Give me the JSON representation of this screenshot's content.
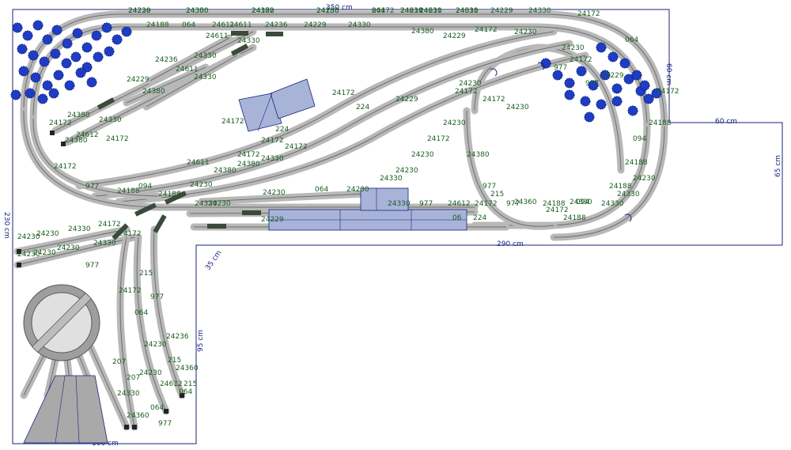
{
  "colors": {
    "board_outline": "#1a237e",
    "track_bed": "#b8b8b8",
    "track_rail": "#6e6e6e",
    "building_fill": "#a8b3d8",
    "building_stroke": "#1a237e",
    "tree": "#1f3cc4",
    "part_label": "#1b5e20",
    "loco": "#3b4a3b"
  },
  "dimensions": {
    "top_length": "350 cm",
    "right_upper_depth": "60 cm",
    "step_width": "60 cm",
    "right_lower_depth": "65 cm",
    "left_height": "230 cm",
    "bottom_width": "290 cm",
    "inner_depth": "35 cm",
    "branch_height": "95 cm",
    "branch_width": "100 cm"
  },
  "track_labels": [
    "24229",
    "24360",
    "24380",
    "24188",
    "064",
    "24611",
    "24611",
    "24611",
    "24229",
    "24330",
    "24172",
    "24188",
    "064",
    "24611",
    "24611",
    "24236",
    "24229",
    "24330",
    "24380",
    "24229",
    "24172",
    "24236",
    "24611",
    "24229",
    "24611",
    "24330",
    "24330",
    "24380",
    "24330",
    "24230",
    "24230",
    "24229",
    "24172",
    "224",
    "24611",
    "24172",
    "24172",
    "24172",
    "224",
    "24229",
    "24380",
    "24380",
    "24330",
    "24172",
    "24172",
    "24380",
    "24330",
    "24380",
    "24612",
    "24172",
    "24172",
    "24380",
    "977",
    "24172",
    "24188",
    "977",
    "094",
    "24188",
    "24230",
    "24330",
    "24230",
    "24230",
    "064",
    "24230",
    "24330",
    "977",
    "24612",
    "06",
    "24172",
    "224",
    "24229",
    "977",
    "24188",
    "24188",
    "094",
    "24188",
    "24188",
    "094",
    "24188",
    "24172",
    "064",
    "24230",
    "24230",
    "24330",
    "24172",
    "24230",
    "24230",
    "24230",
    "24330",
    "977",
    "24172",
    "24172",
    "215",
    "977",
    "064",
    "24236",
    "215",
    "24612",
    "215",
    "24230",
    "24230",
    "207",
    "207",
    "24330",
    "24360",
    "064",
    "977",
    "24360",
    "064",
    "977",
    "24172",
    "977",
    "215",
    "24360",
    "24172",
    "24330",
    "24330",
    "24330",
    "24230",
    "24230",
    "24172",
    "24230",
    "24230",
    "24172",
    "24230",
    "24230",
    "24330",
    "24230",
    "24330",
    "24172",
    "24230",
    "24172",
    "24230",
    "24230",
    "24330"
  ]
}
